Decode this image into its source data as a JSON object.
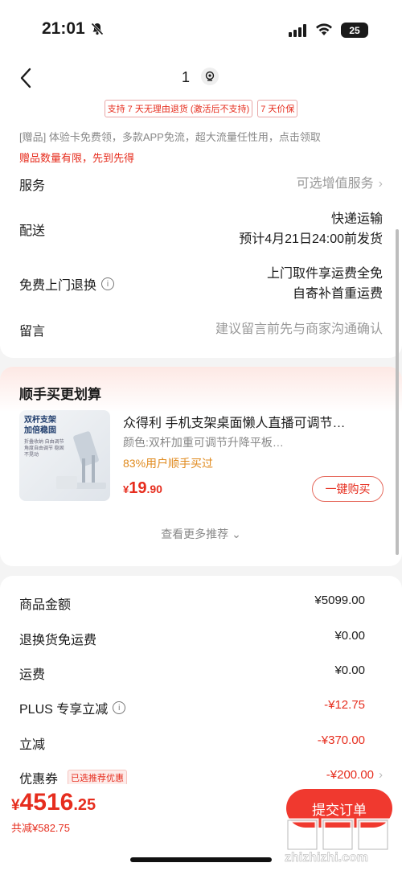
{
  "status": {
    "time": "21:01",
    "battery": "25"
  },
  "nav": {
    "title": "1"
  },
  "guarantees": [
    "支持 7 天无理由退货 (激活后不支持)",
    "7 天价保"
  ],
  "gift": {
    "text": "[赠品] 体验卡免费领，多款APP免流，超大流量任性用，点击领取",
    "warning": "赠品数量有限，先到先得"
  },
  "rows": {
    "service": {
      "label": "服务",
      "value": "可选增值服务"
    },
    "delivery": {
      "label": "配送",
      "value1": "快递运输",
      "value2": "预计4月21日24:00前发货"
    },
    "returns": {
      "label": "免费上门退换",
      "value1": "上门取件享运费全免",
      "value2": "自寄补首重运费"
    },
    "message": {
      "label": "留言",
      "placeholder": "建议留言前先与商家沟通确认"
    }
  },
  "recommend": {
    "section_title": "顺手买更划算",
    "thumb_title_1": "双杆支架",
    "thumb_title_2": "加倍稳固",
    "thumb_sub": "折叠收纳 自由调节 角度自由调节 稳固不晃动",
    "name": "众得利 手机支架桌面懒人直播可调节…",
    "spec": "颜色:双杆加重可调节升降平板…",
    "tag": "83%用户顺手买过",
    "price_cur": "¥",
    "price_int": "19",
    "price_dec": ".90",
    "buy_label": "一键购买",
    "more_label": "查看更多推荐"
  },
  "summary": {
    "goods": {
      "label": "商品金额",
      "value": "¥5099.00"
    },
    "return_shipping": {
      "label": "退换货免运费",
      "value": "¥0.00"
    },
    "shipping": {
      "label": "运费",
      "value": "¥0.00"
    },
    "plus": {
      "label": "PLUS 专享立减",
      "value": "-¥12.75"
    },
    "instant": {
      "label": "立减",
      "value": "-¥370.00"
    },
    "coupon": {
      "label": "优惠券",
      "tag": "已选推荐优惠",
      "value": "-¥200.00"
    }
  },
  "bottom": {
    "cur": "¥",
    "total_int": "4516",
    "total_dec": ".25",
    "saved": "共减¥582.75",
    "submit": "提交订单"
  },
  "watermark": {
    "text": "zhizhizhi.com"
  },
  "colors": {
    "accent": "#e62d1e",
    "orange": "#e08a1e"
  }
}
